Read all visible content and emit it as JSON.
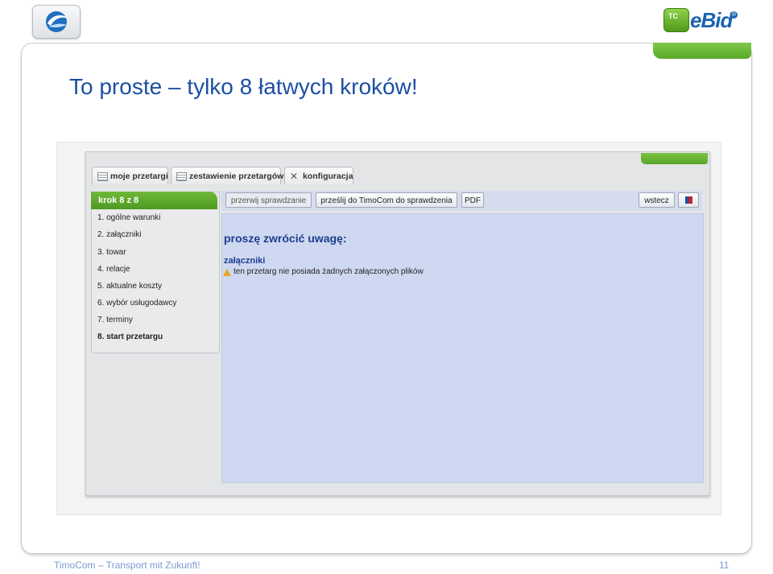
{
  "header": {
    "logo_left_icon": "timocom-logo",
    "logo_right_icon": "ebid-logo",
    "brand_badge": "TC",
    "brand_name": "eBid",
    "brand_reg": "®"
  },
  "slide": {
    "title": "To proste – tylko 8 łatwych kroków!",
    "accent_color": "#5aa829",
    "title_color": "#1c4fa3"
  },
  "app": {
    "tabs": [
      {
        "label": "moje przetargi",
        "icon": "list-icon"
      },
      {
        "label": "zestawienie przetargów",
        "icon": "list-icon"
      },
      {
        "label": "konfiguracja",
        "icon": "tools-icon"
      }
    ],
    "steps_header": "krok 8 z 8",
    "steps": [
      "1. ogólne warunki",
      "2. załączniki",
      "3. towar",
      "4. relacje",
      "5. aktualne koszty",
      "6. wybór usługodawcy",
      "7. terminy",
      "8. start przetargu"
    ],
    "active_step_index": 7,
    "toolbar": {
      "stop_label": "przerwij sprawdzanie",
      "send_label": "prześlij do TimoCom do sprawdzenia",
      "pdf_label": "PDF",
      "back_label": "wstecz",
      "flag_icon": "flag-icon"
    },
    "content": {
      "attention": "proszę zwrócić uwagę:",
      "section": "załączniki",
      "warning": "ten przetarg nie posiada żadnych załączonych plików",
      "warning_icon": "warning-icon"
    }
  },
  "footer": {
    "left": "TimoCom – Transport mit Zukunft!",
    "page": "11"
  }
}
